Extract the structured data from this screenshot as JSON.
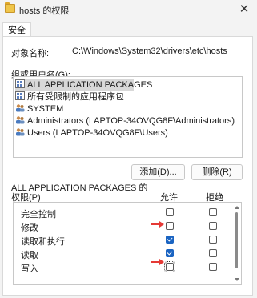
{
  "window": {
    "title": "hosts 的权限",
    "close_icon": "close-icon"
  },
  "tabs": [
    {
      "label": "安全"
    }
  ],
  "object": {
    "label": "对象名称:",
    "value": "C:\\Windows\\System32\\drivers\\etc\\hosts"
  },
  "groups": {
    "label": "组或用户名(G):",
    "items": [
      {
        "label": "ALL APPLICATION PACKAGES",
        "icon": "group-icon",
        "selected": true
      },
      {
        "label": "所有受限制的应用程序包",
        "icon": "group-icon",
        "selected": false
      },
      {
        "label": "SYSTEM",
        "icon": "group-icon",
        "selected": false
      },
      {
        "label": "Administrators (LAPTOP-34OVQG8F\\Administrators)",
        "icon": "group-icon",
        "selected": false
      },
      {
        "label": "Users (LAPTOP-34OVQG8F\\Users)",
        "icon": "group-icon",
        "selected": false
      }
    ]
  },
  "buttons": {
    "add": "添加(D)...",
    "remove": "删除(R)"
  },
  "permissions": {
    "for_label": "ALL APPLICATION PACKAGES 的",
    "header": "权限(P)",
    "allow_header": "允许",
    "deny_header": "拒绝",
    "rows": [
      {
        "name": "完全控制",
        "allow": false,
        "deny": false
      },
      {
        "name": "修改",
        "allow": false,
        "deny": false
      },
      {
        "name": "读取和执行",
        "allow": true,
        "deny": false
      },
      {
        "name": "读取",
        "allow": true,
        "deny": false
      },
      {
        "name": "写入",
        "allow": false,
        "deny": false
      }
    ]
  },
  "colors": {
    "accent": "#1a64c2",
    "annotation_arrow": "#e53935"
  }
}
